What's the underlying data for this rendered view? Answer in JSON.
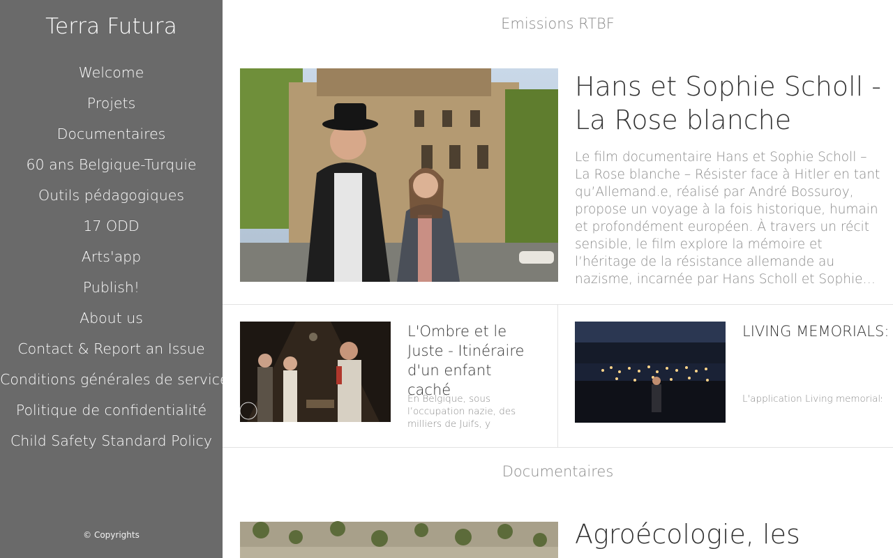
{
  "sidebar": {
    "title": "Terra Futura",
    "nav": [
      "Welcome",
      "Projets",
      "Documentaires",
      "60 ans Belgique-Turquie",
      "Outils pédagogiques",
      "17 ODD",
      "Arts'app",
      "Publish!",
      "About us",
      "Contact & Report an Issue",
      "Conditions générales de service",
      "Politique de confidentialité",
      "Child Safety Standard Policy"
    ],
    "copyright": "© Copyrights"
  },
  "sections": [
    {
      "title": "Emissions RTBF",
      "hero": {
        "title": "Hans et Sophie Scholl - La Rose blanche",
        "excerpt": "Le film documentaire Hans et Sophie Scholl – La Rose blanche – Résister face à Hitler en tant qu’Allemand.e, réalisé par André Bossuroy, propose un voyage à la fois historique, humain et profondément européen. À travers un récit sensible, le film explore la mémoire et l’héritage de la résistance allemande au nazisme, incarnée par Hans Scholl et Sophie…"
      },
      "cards": [
        {
          "title": "L'Ombre et le Juste - Itinéraire d'un enfant caché",
          "excerpt": "En Belgique, sous l’occupation nazie, des milliers de Juifs, y compris…"
        },
        {
          "title": "LIVING MEMORIALS: {Re}vitalize digita…",
          "excerpt": "L'application Living memorials"
        }
      ]
    },
    {
      "title": "Documentaires",
      "hero": {
        "title": "Agroécologie, les"
      }
    }
  ],
  "colors": {
    "sidebar_bg": "#6a6a6a",
    "text_dark": "#333333",
    "text_muted": "#8a8a8a",
    "divider": "#e2e2e2"
  }
}
